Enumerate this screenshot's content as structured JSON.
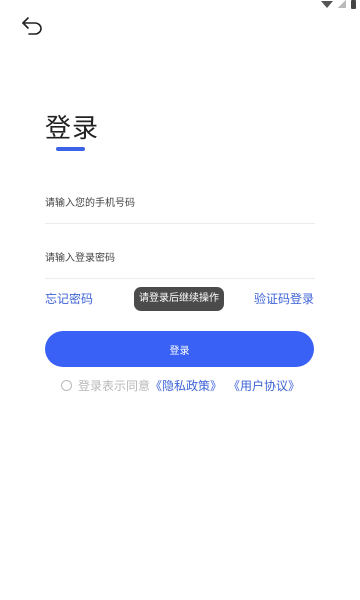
{
  "status_bar": {
    "icons": [
      "wifi-icon",
      "signal-icon",
      "battery-icon"
    ]
  },
  "header": {
    "back_icon": "back-arrow-icon"
  },
  "login": {
    "title": "登录",
    "phone_placeholder": "请输入您的手机号码",
    "password_placeholder": "请输入登录密码",
    "forgot_password": "忘记密码",
    "sms_login": "验证码登录",
    "toast": "请登录后继续操作",
    "submit_label": "登录",
    "agreement_prefix": "登录表示同意",
    "privacy_policy": "《隐私政策》",
    "user_agreement": "《用户协议》"
  },
  "colors": {
    "accent": "#3a61f5",
    "link": "#3d63d6",
    "toast_bg": "#4b4b4b",
    "muted_text": "#b8b8b8"
  }
}
